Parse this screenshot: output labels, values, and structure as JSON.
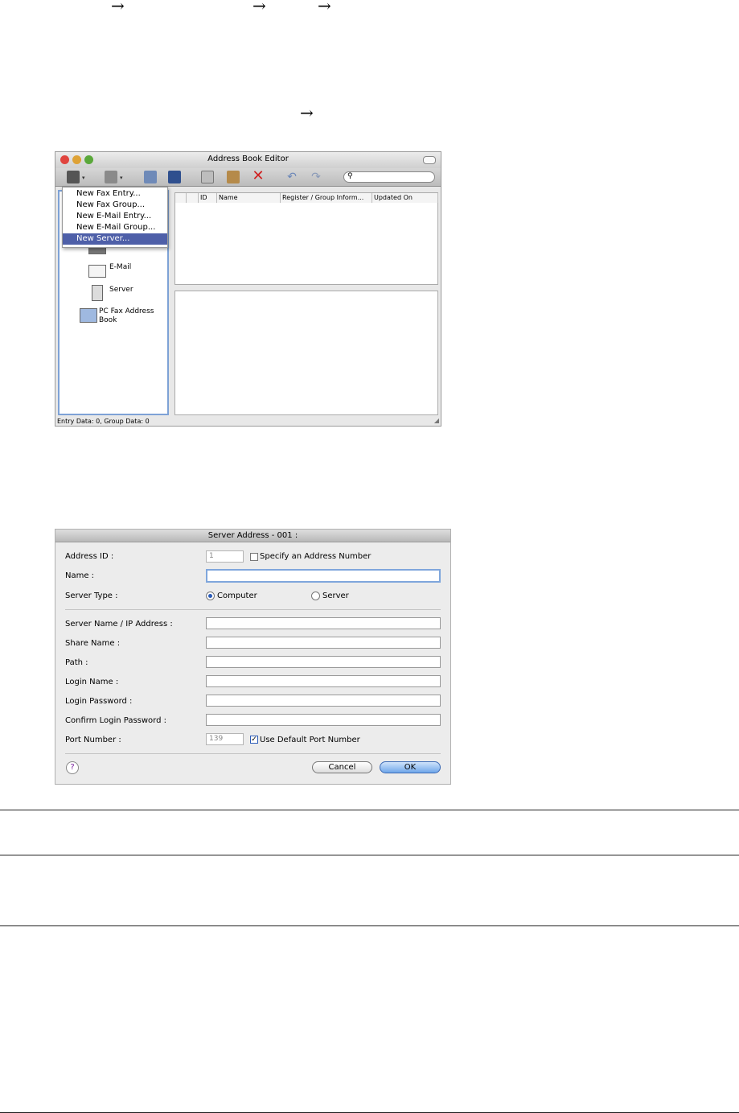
{
  "arrows": [
    "→",
    "→",
    "→",
    "→"
  ],
  "address_book_editor": {
    "title": "Address Book Editor",
    "menu": [
      "New Fax Entry...",
      "New Fax Group...",
      "New E-Mail Entry...",
      "New E-Mail Group...",
      "New Server..."
    ],
    "selected_menu_item": "New Server...",
    "tree": [
      "E-Mail",
      "Server",
      "PC Fax Address Book"
    ],
    "columns": [
      "ID",
      "Name",
      "Register / Group Inform...",
      "Updated On"
    ],
    "status": "Entry Data: 0, Group Data: 0",
    "icons": [
      "new-entry-icon",
      "import-icon",
      "edit-icon",
      "save-icon",
      "copy-icon",
      "paste-icon",
      "delete-icon",
      "undo-icon",
      "redo-icon",
      "search-icon"
    ]
  },
  "server_dialog": {
    "title": "Server Address - 001 :",
    "address_id_label": "Address ID :",
    "address_id_value": "1",
    "specify_label": "Specify an Address Number",
    "name_label": "Name :",
    "server_type_label": "Server Type :",
    "computer_label": "Computer",
    "server_label": "Server",
    "server_type_selected": "Computer",
    "server_name_label": "Server Name / IP Address :",
    "share_name_label": "Share Name :",
    "path_label": "Path :",
    "login_name_label": "Login Name :",
    "login_password_label": "Login Password :",
    "confirm_password_label": "Confirm Login Password :",
    "port_label": "Port Number :",
    "port_value": "139",
    "use_default_port_label": "Use Default Port Number",
    "use_default_port_checked": true,
    "help_label": "?",
    "cancel_label": "Cancel",
    "ok_label": "OK"
  }
}
